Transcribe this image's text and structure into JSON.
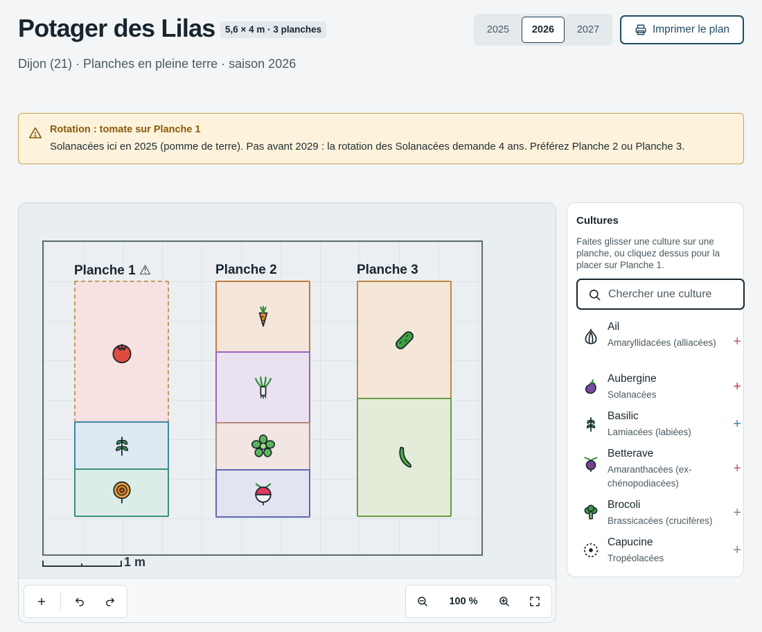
{
  "header": {
    "title": "Potager des Lilas",
    "badge": "5,6 × 4 m · 3 planches",
    "subtitle": "Dijon (21) · Planches en pleine terre · saison 2026",
    "years": [
      "2025",
      "2026",
      "2027"
    ],
    "selected_year": "2026",
    "print_label": "Imprimer le plan"
  },
  "alert": {
    "title": "Rotation : tomate sur Planche 1",
    "body": "Solanacées ici en 2025 (pomme de terre). Pas avant 2029 : la rotation des Solanacées demande 4 ans. Préférez Planche 2 ou Planche 3."
  },
  "beds": [
    {
      "label": "Planche 1 ⚠",
      "warning": true,
      "plots": [
        {
          "crop": "tomato-icon",
          "fill": "#f7e1e1",
          "border": "#c49a5a",
          "dashed": true
        },
        {
          "crop": "basil-icon",
          "fill": "#dde8f0",
          "border": "#3f84a6"
        },
        {
          "crop": "marigold-icon",
          "fill": "#dcece7",
          "border": "#3b8f78"
        }
      ]
    },
    {
      "label": "Planche 2",
      "plots": [
        {
          "crop": "carrot-icon",
          "fill": "#f5e6dc",
          "border": "#c07a3b"
        },
        {
          "crop": "leek-icon",
          "fill": "#ebe2f1",
          "border": "#9a63b8"
        },
        {
          "crop": "lettuce-icon",
          "fill": "#f1e6e2",
          "border": "#b08a7a"
        },
        {
          "crop": "radish-icon",
          "fill": "#e3e4f2",
          "border": "#5d67b0"
        }
      ]
    },
    {
      "label": "Planche 3",
      "plots": [
        {
          "crop": "cucumber-icon",
          "fill": "#f4e7d8",
          "border": "#c08640"
        },
        {
          "crop": "bean-icon",
          "fill": "#e3ecd9",
          "border": "#6b9a43"
        }
      ]
    }
  ],
  "scale_label": "1 m",
  "toolbar": {
    "zoom": "100 %"
  },
  "panel": {
    "title": "Cultures",
    "help": "Faites glisser une culture sur une planche, ou cliquez dessus pour la placer sur Planche 1.",
    "search_placeholder": "Chercher une culture",
    "crops": [
      {
        "name": "Ail",
        "family": "Amaryllidacées (alliacées)",
        "icon": "garlic-icon",
        "add_color": "#b0607a"
      },
      {
        "name": "Aubergine",
        "family": "Solanacées",
        "icon": "eggplant-icon",
        "add_color": "#c9444a"
      },
      {
        "name": "Basilic",
        "family": "Lamiacées (labiées)",
        "icon": "basil-icon",
        "add_color": "#3f84a6"
      },
      {
        "name": "Betterave",
        "family": "Amaranthacées (ex-chénopodiacées)",
        "icon": "beet-icon",
        "add_color": "#b0607a"
      },
      {
        "name": "Brocoli",
        "family": "Brassicacées (crucifères)",
        "icon": "broccoli-icon",
        "add_color": "#7b8a92"
      },
      {
        "name": "Capucine",
        "family": "Tropéolacées",
        "icon": "nasturtium-icon",
        "add_color": "#7b8a92"
      }
    ]
  }
}
